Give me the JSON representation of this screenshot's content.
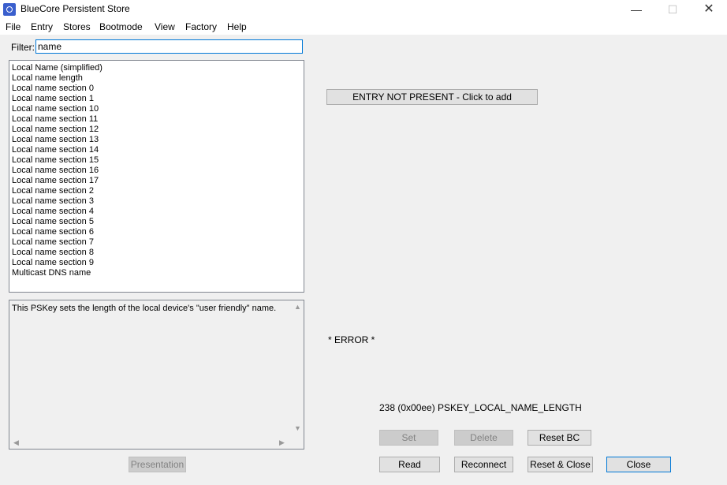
{
  "window": {
    "title": "BlueCore Persistent Store",
    "min_glyph": "—",
    "max_glyph": "☐",
    "close_glyph": "✕"
  },
  "menu": [
    "File",
    "Entry",
    "Stores",
    "Bootmode",
    "View",
    "Factory",
    "Help"
  ],
  "filter": {
    "label": "Filter:",
    "value": "name"
  },
  "list_items": [
    "Local Name (simplified)",
    "Local name length",
    "Local name section 0",
    "Local name section 1",
    "Local name section 10",
    "Local name section 11",
    "Local name section 12",
    "Local name section 13",
    "Local name section 14",
    "Local name section 15",
    "Local name section 16",
    "Local name section 17",
    "Local name section 2",
    "Local name section 3",
    "Local name section 4",
    "Local name section 5",
    "Local name section 6",
    "Local name section 7",
    "Local name section 8",
    "Local name section 9",
    "Multicast DNS name"
  ],
  "description": "This PSKey sets the length of the local device's \"user friendly\" name.",
  "entry_button": "ENTRY NOT PRESENT - Click to add",
  "error_text": "* ERROR *",
  "key_info": "238 (0x00ee) PSKEY_LOCAL_NAME_LENGTH",
  "buttons": {
    "presentation": "Presentation",
    "set": "Set",
    "delete": "Delete",
    "reset_bc": "Reset BC",
    "read": "Read",
    "reconnect": "Reconnect",
    "reset_close": "Reset & Close",
    "close": "Close"
  }
}
